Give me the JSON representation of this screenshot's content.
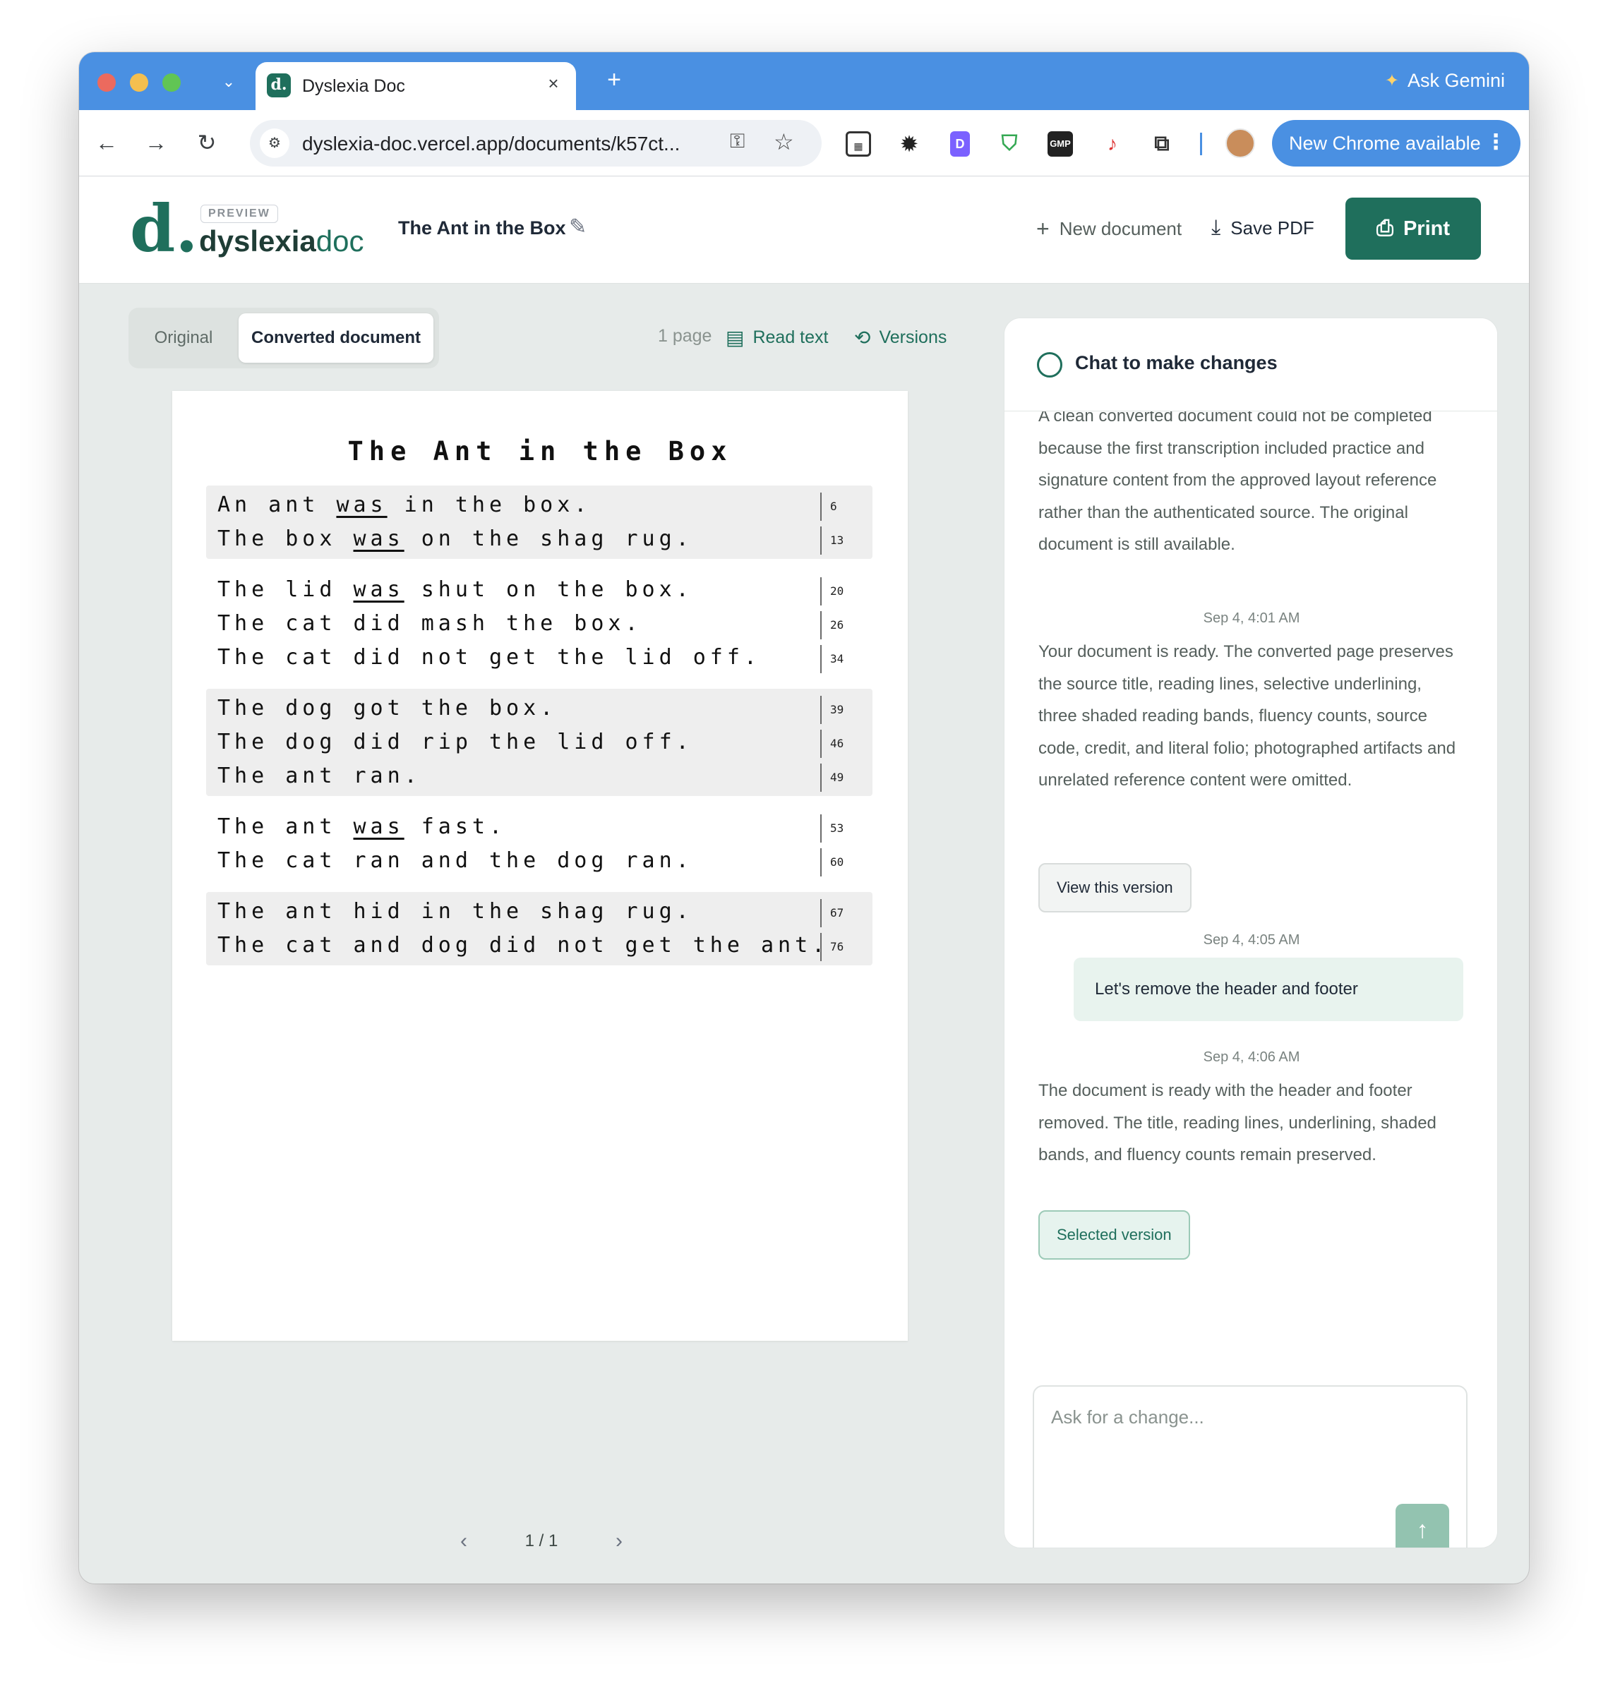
{
  "browser": {
    "tab_title": "Dyslexia Doc",
    "tab_favicon": "d.",
    "gemini_label": "Ask Gemini",
    "url": "dyslexia-doc.vercel.app/documents/k57ct...",
    "update_label": "New Chrome available"
  },
  "header": {
    "logo_mark": "d.",
    "preview_badge": "PREVIEW",
    "wordmark_bold": "dyslexia",
    "wordmark_light": "doc",
    "doc_title": "The Ant in the Box",
    "new_document": "New document",
    "save_pdf": "Save PDF",
    "print": "Print"
  },
  "doc_toolbar": {
    "tab_original": "Original",
    "tab_converted": "Converted document",
    "page_count": "1 page",
    "read_text": "Read text",
    "versions": "Versions"
  },
  "document": {
    "title": "The Ant in the Box",
    "bands": [
      {
        "shaded": true,
        "lines": [
          {
            "parts": [
              {
                "t": "An ant "
              },
              {
                "t": "was",
                "u": true
              },
              {
                "t": " in the box."
              }
            ],
            "count": "6"
          },
          {
            "parts": [
              {
                "t": "The box "
              },
              {
                "t": "was",
                "u": true
              },
              {
                "t": " on the shag rug."
              }
            ],
            "count": "13"
          }
        ]
      },
      {
        "shaded": false,
        "lines": [
          {
            "parts": [
              {
                "t": "The lid "
              },
              {
                "t": "was",
                "u": true
              },
              {
                "t": " shut on the box."
              }
            ],
            "count": "20"
          },
          {
            "parts": [
              {
                "t": "The cat did mash the box."
              }
            ],
            "count": "26"
          },
          {
            "parts": [
              {
                "t": "The cat did not get the lid off."
              }
            ],
            "count": "34"
          }
        ]
      },
      {
        "shaded": true,
        "lines": [
          {
            "parts": [
              {
                "t": "The dog got the box."
              }
            ],
            "count": "39"
          },
          {
            "parts": [
              {
                "t": "The dog did rip the lid off."
              }
            ],
            "count": "46"
          },
          {
            "parts": [
              {
                "t": "The ant ran."
              }
            ],
            "count": "49"
          }
        ]
      },
      {
        "shaded": false,
        "lines": [
          {
            "parts": [
              {
                "t": "The ant "
              },
              {
                "t": "was",
                "u": true
              },
              {
                "t": " fast."
              }
            ],
            "count": "53"
          },
          {
            "parts": [
              {
                "t": "The cat ran and the dog ran."
              }
            ],
            "count": "60"
          }
        ]
      },
      {
        "shaded": true,
        "lines": [
          {
            "parts": [
              {
                "t": "The ant hid in the shag rug."
              }
            ],
            "count": "67"
          },
          {
            "parts": [
              {
                "t": "The cat and dog did not get the ant."
              }
            ],
            "count": "76"
          }
        ]
      }
    ]
  },
  "pager": {
    "label": "1 / 1"
  },
  "chat": {
    "title": "Chat to make changes",
    "msg1": "A clean converted document could not be completed because the first transcription included practice and signature content from the approved layout reference rather than the authenticated source. The original document is still available.",
    "stamp1": "Sep 4, 4:01 AM",
    "msg2": "Your document is ready. The converted page preserves the source title, reading lines, selective underlining, three shaded reading bands, fluency counts, source code, credit, and literal folio; photographed artifacts and unrelated reference content were omitted.",
    "view_version": "View this version",
    "stamp2": "Sep 4, 4:05 AM",
    "user_msg": "Let's remove the header and footer",
    "stamp3": "Sep 4, 4:06 AM",
    "msg3": "The document is ready with the header and footer removed. The title, reading lines, underlining, shaded bands, and fluency counts remain preserved.",
    "selected_version": "Selected version",
    "input_placeholder": "Ask for a change..."
  },
  "colors": {
    "brand": "#1f6f5c",
    "chrome_blue": "#4a90e2",
    "band_shade": "#eeeeee"
  }
}
